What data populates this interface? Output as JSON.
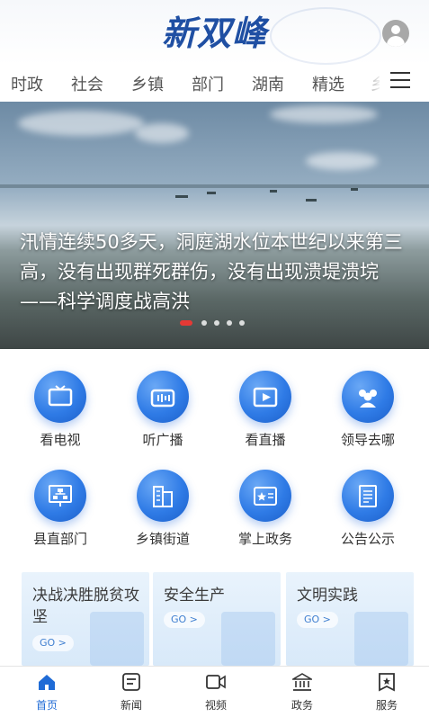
{
  "header": {
    "logo_text": "新双峰",
    "avatar_icon": "user-avatar-icon"
  },
  "tabs": [
    "时政",
    "社会",
    "乡镇",
    "部门",
    "湖南",
    "精选",
    "乡"
  ],
  "banner": {
    "headline": "汛情连续50多天，洞庭湖水位本世纪以来第三高，没有出现群死群伤，没有出现溃堤溃垸——科学调度战高洪",
    "slide_count": 5,
    "active_slide": 1
  },
  "grid": [
    {
      "label": "看电视",
      "icon": "tv-icon"
    },
    {
      "label": "听广播",
      "icon": "radio-icon"
    },
    {
      "label": "看直播",
      "icon": "live-video-icon"
    },
    {
      "label": "领导去哪",
      "icon": "people-icon"
    },
    {
      "label": "县直部门",
      "icon": "org-chart-icon"
    },
    {
      "label": "乡镇街道",
      "icon": "buildings-icon"
    },
    {
      "label": "掌上政务",
      "icon": "gov-star-icon"
    },
    {
      "label": "公告公示",
      "icon": "notice-icon"
    }
  ],
  "cards": [
    {
      "title": "决战决胜脱贫攻坚",
      "go": "GO >"
    },
    {
      "title": "安全生产",
      "go": "GO >"
    },
    {
      "title": "文明实践",
      "go": "GO >"
    }
  ],
  "bottom_nav": [
    {
      "label": "首页",
      "icon": "home-icon",
      "active": true
    },
    {
      "label": "新闻",
      "icon": "news-icon",
      "active": false
    },
    {
      "label": "视频",
      "icon": "video-icon",
      "active": false
    },
    {
      "label": "政务",
      "icon": "government-icon",
      "active": false
    },
    {
      "label": "服务",
      "icon": "service-icon",
      "active": false
    }
  ],
  "colors": {
    "accent": "#1f6bd6",
    "logo": "#1f4fa3",
    "active_dot": "#e53935"
  }
}
